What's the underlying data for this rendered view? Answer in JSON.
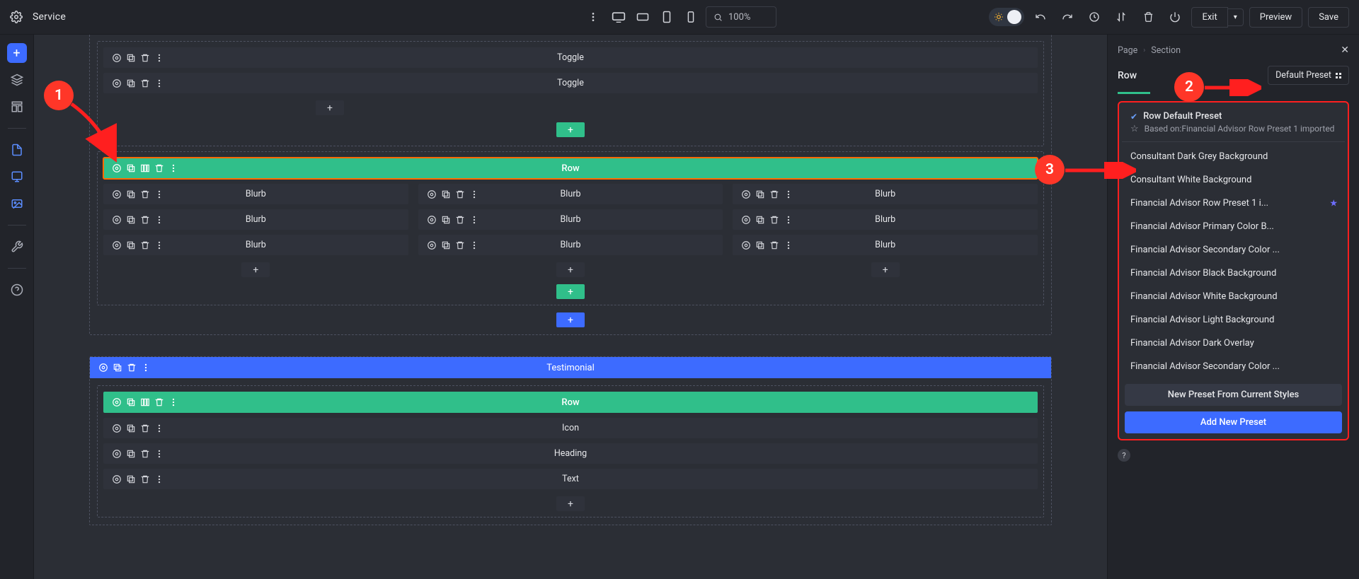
{
  "topbar": {
    "page_title": "Service",
    "zoom": "100%",
    "exit": "Exit",
    "preview": "Preview",
    "save": "Save"
  },
  "breadcrumbs": {
    "page": "Page",
    "section": "Section"
  },
  "panel": {
    "title": "Row",
    "preset_btn": "Default Preset",
    "current": {
      "title": "Row Default Preset",
      "based_on_label": "Based on:",
      "based_on_value": "Financial Advisor Row Preset 1 imported"
    },
    "items": [
      "Consultant Dark Grey Background",
      "Consultant White Background",
      "Financial Advisor Row Preset 1 i...",
      "Financial Advisor Primary Color B...",
      "Financial Advisor Secondary Color ...",
      "Financial Advisor Black Background",
      "Financial Advisor White Background",
      "Financial Advisor Light Background",
      "Financial Advisor Dark Overlay",
      "Financial Advisor Secondary Color ..."
    ],
    "new_from_current": "New Preset From Current Styles",
    "add_new": "Add New Preset"
  },
  "canvas": {
    "toggle": "Toggle",
    "row": "Row",
    "blurb": "Blurb",
    "testimonial": "Testimonial",
    "icon": "Icon",
    "heading": "Heading",
    "text": "Text"
  },
  "annotations": {
    "one": "1",
    "two": "2",
    "three": "3"
  }
}
